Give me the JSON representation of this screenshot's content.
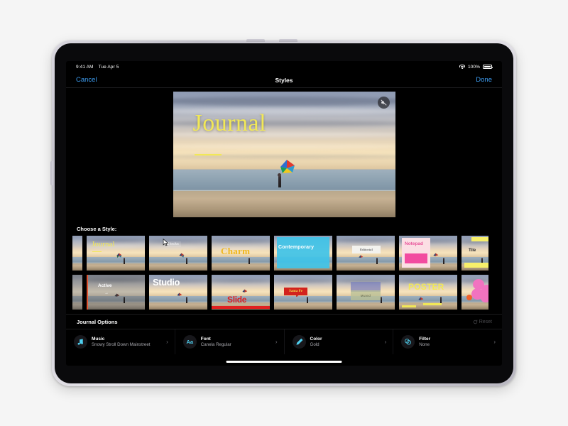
{
  "status_bar": {
    "time": "9:41 AM",
    "date": "Tue Apr 5",
    "wifi_icon": "wifi-icon",
    "battery_percent": "100%",
    "battery_icon": "battery-full-icon"
  },
  "nav": {
    "cancel_label": "Cancel",
    "title": "Styles",
    "done_label": "Done"
  },
  "preview": {
    "title_text": "Journal",
    "mute_icon": "speaker-slash-icon",
    "scene_description": "beach-sunset-with-kite"
  },
  "choose_style": {
    "label": "Choose a Style:",
    "rows": [
      [
        {
          "name": "clipped-left",
          "label": "",
          "selected": false
        },
        {
          "name": "Journal",
          "label": "Journal",
          "selected": true
        },
        {
          "name": "Blocks",
          "label": "Blocks",
          "selected": false
        },
        {
          "name": "Charm",
          "label": "Charm",
          "selected": false
        },
        {
          "name": "Contemporary",
          "label": "Contemporary",
          "selected": false
        },
        {
          "name": "Editorial",
          "label": "Editorial",
          "selected": false
        },
        {
          "name": "Notepad",
          "label": "Notepad",
          "selected": false
        },
        {
          "name": "Tile",
          "label": "Tile",
          "selected": false
        }
      ],
      [
        {
          "name": "clipped-left",
          "label": "",
          "selected": false
        },
        {
          "name": "Active",
          "label": "Active",
          "selected": false
        },
        {
          "name": "Studio",
          "label": "Studio",
          "selected": false
        },
        {
          "name": "Slide",
          "label": "Slide",
          "selected": false
        },
        {
          "name": "Santa Fe",
          "label": "Santa Fe",
          "selected": false
        },
        {
          "name": "Muted",
          "label": "Muted",
          "selected": false
        },
        {
          "name": "Poster",
          "label": "POSTER",
          "selected": false
        },
        {
          "name": "Bloom",
          "label": "",
          "selected": false
        }
      ]
    ]
  },
  "options": {
    "section_title": "Journal Options",
    "reset_label": "Reset",
    "reset_icon": "rotate-counterclockwise-icon",
    "items": [
      {
        "icon": "music-note-icon",
        "name": "Music",
        "value": "Snowy Stroll Down Mainstreet",
        "chevron": "›"
      },
      {
        "icon": "aa-text-icon",
        "name": "Font",
        "value": "Canela Regular",
        "chevron": "›"
      },
      {
        "icon": "eyedropper-icon",
        "name": "Color",
        "value": "Gold",
        "chevron": "›"
      },
      {
        "icon": "filter-circles-icon",
        "name": "Filter",
        "value": "None",
        "chevron": "›"
      }
    ]
  },
  "colors": {
    "accent_blue": "#3d9cf0",
    "selection_cyan": "#49c7e8",
    "title_yellow": "#f2e857",
    "icon_cyan": "#4fd0ef",
    "page_background": "#f5f5f5",
    "screen_background": "#000000"
  },
  "device": {
    "type": "tablet",
    "home_indicator": "home-indicator"
  }
}
